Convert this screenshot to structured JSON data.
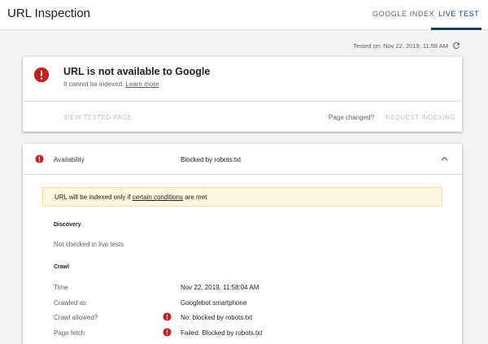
{
  "header": {
    "title": "URL Inspection",
    "tabs": [
      {
        "label": "GOOGLE INDEX",
        "active": false
      },
      {
        "label": "LIVE TEST",
        "active": true
      }
    ],
    "accent_color": "#1a3b5d"
  },
  "test_info": {
    "tested_on": "Tested on: Nov 22, 2019, 11:58 AM",
    "refresh_icon": "refresh-icon"
  },
  "status_card": {
    "icon": "error-icon",
    "icon_color": "#c5221f",
    "title": "URL is not available to Google",
    "subtitle": "It cannot be indexed.",
    "learn_more": "Learn more",
    "view_tested_page": "VIEW TESTED PAGE",
    "page_changed": "Page changed?",
    "request_indexing": "REQUEST INDEXING"
  },
  "availability": {
    "label": "Availability",
    "value": "Blocked by robots.txt",
    "expanded": true,
    "warning": {
      "prefix": "URL will be indexed only if ",
      "link": "certain conditions",
      "suffix": " are met"
    },
    "discovery": {
      "heading": "Discovery",
      "value": "Not checked in live tests"
    },
    "crawl": {
      "heading": "Crawl",
      "rows": [
        {
          "label": "Time",
          "value": "Nov 22, 2019, 11:58:04 AM",
          "error": false
        },
        {
          "label": "Crawled as",
          "value": "Googlebot smartphone",
          "error": false
        },
        {
          "label": "Crawl allowed?",
          "value": "No: blocked by robots.txt",
          "error": true
        },
        {
          "label": "Page fetch",
          "value": "Failed: Blocked by robots.txt",
          "error": true
        }
      ]
    }
  }
}
